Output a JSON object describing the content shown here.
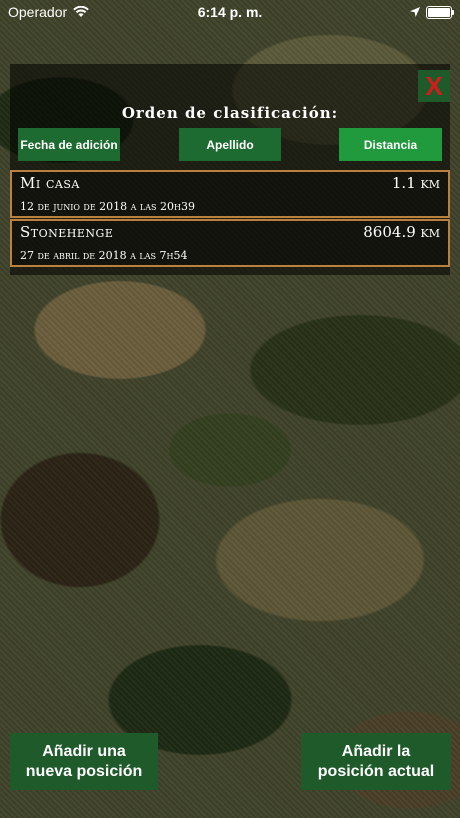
{
  "status_bar": {
    "carrier": "Operador",
    "time": "6:14 p. m."
  },
  "close_label": "X",
  "sort": {
    "title": "Orden de clasificación:",
    "buttons": [
      {
        "label": "Fecha de adición"
      },
      {
        "label": "Apellido"
      },
      {
        "label": "Distancia"
      }
    ],
    "active": "Distancia"
  },
  "positions": [
    {
      "name": "Mi casa",
      "distance": "1.1 km",
      "date": "12 de junio de 2018 a las 20h39"
    },
    {
      "name": "Stonehenge",
      "distance": "8604.9 km",
      "date": "27 de abril de 2018 a las 7h54"
    }
  ],
  "actions": {
    "add_new": "Añadir una\nnueva posición",
    "add_current": "Añadir la\nposición actual"
  },
  "colors": {
    "button_green": "#1f5a2a",
    "active_green": "#219a3d",
    "row_border": "#b9803f",
    "close_x": "#d21c1c"
  }
}
